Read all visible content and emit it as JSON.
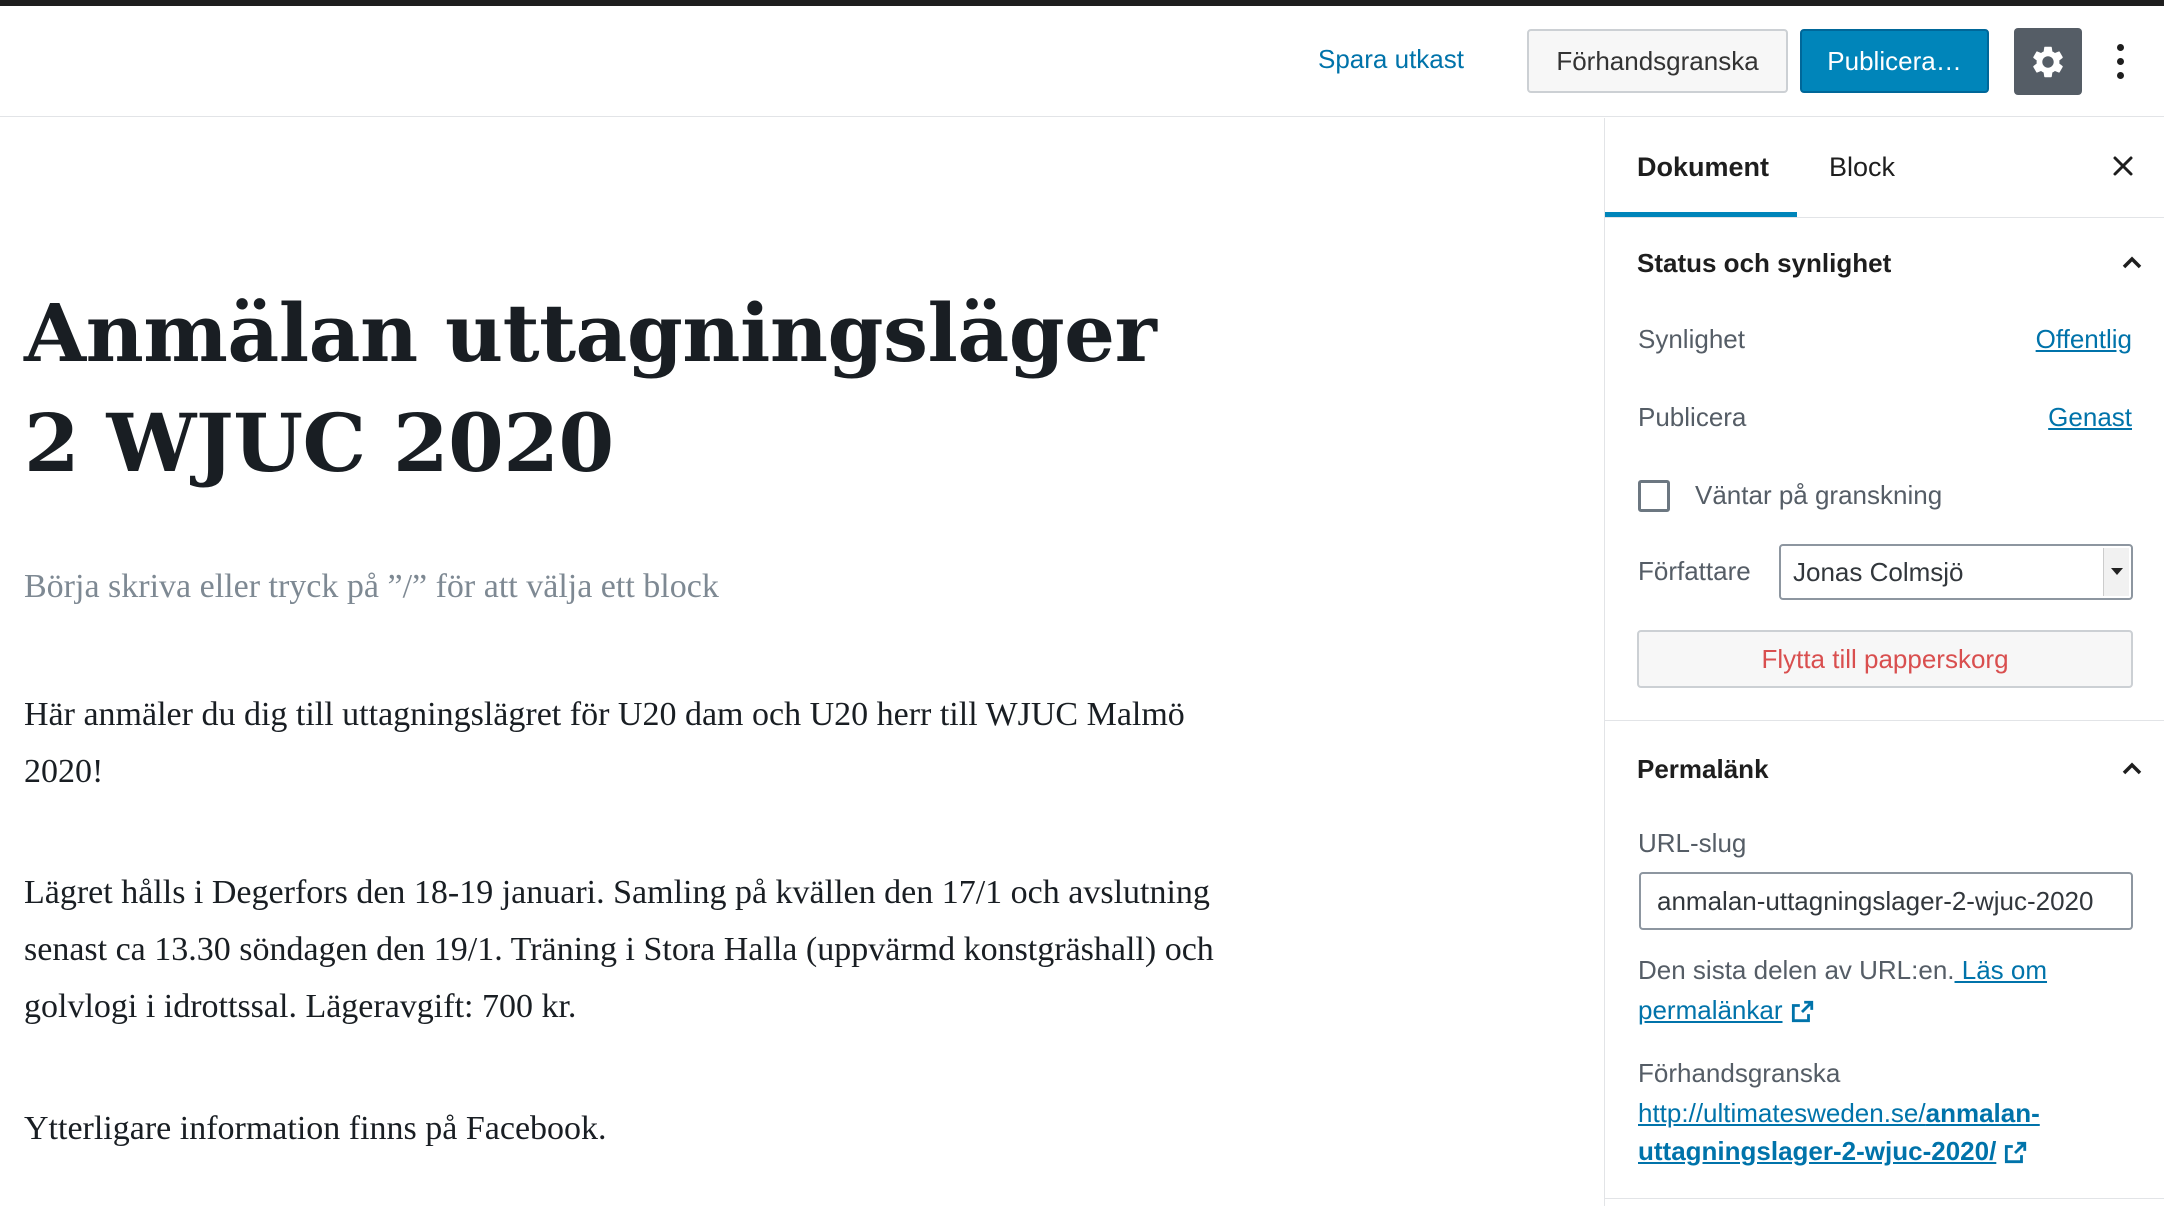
{
  "toolbar": {
    "save_draft": "Spara utkast",
    "preview": "Förhandsgranska",
    "publish": "Publicera…",
    "settings_icon": "gear-icon",
    "more_icon": "vertical-ellipsis-icon"
  },
  "editor": {
    "title": "Anmälan uttagningsläger 2 WJUC 2020",
    "placeholder": "Börja skriva eller tryck på ”/” för att välja ett block",
    "paragraphs": [
      "Här anmäler du dig till uttagningslägret för U20 dam och U20 herr till WJUC Malmö 2020!",
      "Lägret  hålls i Degerfors den 18-19 januari. Samling på kvällen den 17/1 och avslutning senast ca 13.30 söndagen den 19/1. Träning i Stora Halla (uppvärmd konstgräshall) och golvlogi i idrottssal. Lägeravgift: 700  kr.",
      "Ytterligare information finns på Facebook."
    ]
  },
  "sidebar": {
    "tabs": [
      "Dokument",
      "Block"
    ],
    "active_tab": "Dokument",
    "status": {
      "title": "Status och synlighet",
      "visibility_label": "Synlighet",
      "visibility_value": "Offentlig",
      "publish_label": "Publicera",
      "publish_value": "Genast",
      "pending_review": "Väntar på granskning",
      "pending_checked": false,
      "author_label": "Författare",
      "author_value": "Jonas Colmsjö",
      "trash": "Flytta till papperskorg"
    },
    "permalink": {
      "title": "Permalänk",
      "slug_label": "URL-slug",
      "slug_value": "anmalan-uttagningslager-2-wjuc-2020",
      "help_text": "Den sista delen av URL:en.",
      "help_link": " Läs om permalänkar",
      "preview_label": "Förhandsgranska",
      "preview_base": "http://ultimatesweden.se/",
      "preview_slug": "anmalan-uttagningslager-2-wjuc-2020/"
    }
  },
  "colors": {
    "accent": "#0085ba",
    "link": "#0073aa",
    "danger": "#d94f4f"
  }
}
